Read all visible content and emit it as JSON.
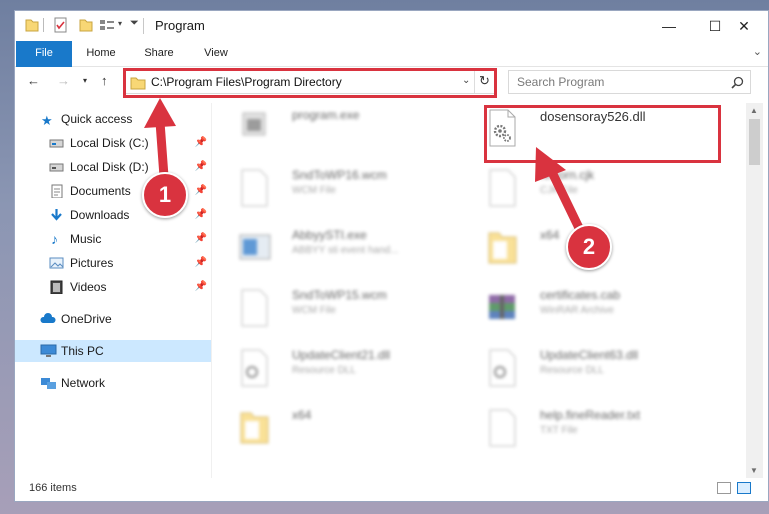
{
  "window": {
    "title": "Program"
  },
  "ribbon": {
    "tabs": [
      {
        "label": "File"
      },
      {
        "label": "Home"
      },
      {
        "label": "Share"
      },
      {
        "label": "View"
      }
    ]
  },
  "address": {
    "path": "C:\\Program Files\\Program Directory"
  },
  "search": {
    "placeholder": "Search Program"
  },
  "sidebar": {
    "items": [
      {
        "label": "Quick access",
        "icon": "star-icon"
      },
      {
        "label": "Local Disk (C:)",
        "icon": "drive-icon"
      },
      {
        "label": "Local Disk (D:)",
        "icon": "drive-icon"
      },
      {
        "label": "Documents",
        "icon": "documents-icon"
      },
      {
        "label": "Downloads",
        "icon": "download-icon"
      },
      {
        "label": "Music",
        "icon": "music-icon"
      },
      {
        "label": "Pictures",
        "icon": "pictures-icon"
      },
      {
        "label": "Videos",
        "icon": "videos-icon"
      },
      {
        "label": "OneDrive",
        "icon": "cloud-icon"
      },
      {
        "label": "This PC",
        "icon": "computer-icon"
      },
      {
        "label": "Network",
        "icon": "network-icon"
      }
    ]
  },
  "files": [
    {
      "name": "program.exe",
      "type": "",
      "icon": "exe-icon"
    },
    {
      "name": "dosensoray526.dll",
      "type": "",
      "icon": "dll-gear-icon"
    },
    {
      "name": "SndToWP16.wcm",
      "type": "WCM File",
      "icon": "file-icon"
    },
    {
      "name": "felcorn.cjk",
      "type": "CJK File",
      "icon": "file-icon"
    },
    {
      "name": "AbbyySTI.exe",
      "type": "ABBYY sti event hand...",
      "icon": "exe-icon"
    },
    {
      "name": "x64",
      "type": "",
      "icon": "folder-icon"
    },
    {
      "name": "SndToWP15.wcm",
      "type": "WCM File",
      "icon": "file-icon"
    },
    {
      "name": "certificates.cab",
      "type": "WinRAR Archive",
      "icon": "archive-icon"
    },
    {
      "name": "UpdateClient21.dll",
      "type": "Resource DLL",
      "icon": "dll-gear-icon"
    },
    {
      "name": "UpdateClient63.dll",
      "type": "Resource DLL",
      "icon": "dll-gear-icon"
    },
    {
      "name": "x64",
      "type": "",
      "icon": "folder-icon"
    },
    {
      "name": "help.fineReader.txt",
      "type": "TXT File",
      "icon": "file-icon"
    }
  ],
  "status": {
    "item_count": "166 items"
  },
  "annotations": {
    "step1": "1",
    "step2": "2"
  },
  "colors": {
    "accent": "#1979ca",
    "annotation_red": "#d9333f",
    "selected": "#cce8ff",
    "folder": "#f8d775"
  }
}
